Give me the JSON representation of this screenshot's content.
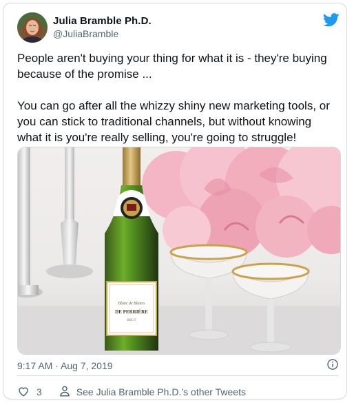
{
  "author": {
    "name": "Julia Bramble Ph.D.",
    "handle": "@JuliaBramble"
  },
  "tweet": {
    "text": "People aren't buying your thing for what it is - they're buying\nbecause of the promise ...\n\nYou can go after all the whizzy shiny new marketing tools, or\nyou can stick to traditional channels, but without knowing\nwhat it is you're really selling, you're going to struggle!",
    "timestamp": "9:17 AM · Aug 7, 2019"
  },
  "image": {
    "label_brand": "DE PERRIÈRE",
    "label_script": "Blanc de Blancs",
    "label_sub": "BRUT"
  },
  "actions": {
    "like_count": "3",
    "other_tweets_label": "See Julia Bramble Ph.D.’s other Tweets"
  },
  "icons": {
    "twitter": "twitter-bird-icon",
    "info": "info-icon",
    "heart": "heart-icon",
    "person": "person-icon"
  },
  "colors": {
    "twitter_blue": "#1d9bf0",
    "secondary_text": "#536471",
    "border": "#cfd9de"
  }
}
